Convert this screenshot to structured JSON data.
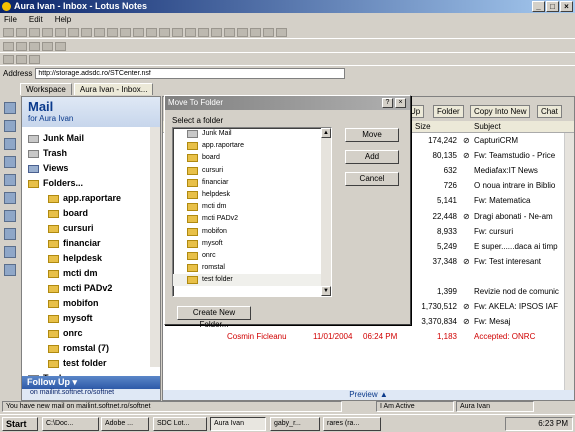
{
  "window": {
    "title": "Aura Ivan - Inbox - Lotus Notes",
    "min": "_",
    "max": "□",
    "close": "×"
  },
  "menu": [
    "File",
    "Edit",
    "Help"
  ],
  "address": {
    "label": "Address",
    "value": "http://storage.adsdc.ro/STCenter.nsf"
  },
  "tabs": [
    {
      "label": "Workspace"
    },
    {
      "label": "Aura Ivan - Inbox..."
    }
  ],
  "nav": {
    "title": "Mail",
    "subtitle": "for Aura Ivan",
    "items": [
      {
        "label": "Junk Mail"
      },
      {
        "label": "Trash"
      },
      {
        "label": "Views"
      },
      {
        "label": "Folders..."
      }
    ],
    "folders": [
      "app.raportare",
      "board",
      "cursuri",
      "financiar",
      "helpdesk",
      "mcti dm",
      "mcti PADv2",
      "mobifon",
      "mysoft",
      "onrc",
      "romstal (7)",
      "test folder"
    ],
    "tools": "Tools",
    "follow_up": "Follow Up",
    "server": "on mailint.softnet.ro/softnet"
  },
  "actions": {
    "up": "Up",
    "folder": "Folder",
    "copy_into_new": "Copy Into New",
    "chat": "Chat"
  },
  "columns": {
    "size": "Size",
    "subject": "Subject"
  },
  "rows": [
    {
      "from": "",
      "date": "",
      "time": "",
      "size": "174,242",
      "attach": "⊘",
      "subject": "CapturiCRM"
    },
    {
      "from": "",
      "date": "",
      "time": "",
      "size": "80,135",
      "attach": "⊘",
      "subject": "Fw: Teamstudio - Price"
    },
    {
      "from": "",
      "date": "",
      "time": "",
      "size": "632",
      "attach": "",
      "subject": "Mediafax:IT News"
    },
    {
      "from": "",
      "date": "",
      "time": "",
      "size": "726",
      "attach": "",
      "subject": "O noua intrare in Biblio"
    },
    {
      "from": "",
      "date": "",
      "time": "",
      "size": "5,141",
      "attach": "",
      "subject": "Fw: Matematica"
    },
    {
      "from": "",
      "date": "",
      "time": "",
      "size": "22,448",
      "attach": "⊘",
      "subject": "Dragi abonati -  Ne-am"
    },
    {
      "from": "",
      "date": "",
      "time": "",
      "size": "8,933",
      "attach": "",
      "subject": "Fw: cursuri"
    },
    {
      "from": "",
      "date": "",
      "time": "",
      "size": "5,249",
      "attach": "",
      "subject": "E super......daca ai timp"
    },
    {
      "from": "",
      "date": "",
      "time": "",
      "size": "37,348",
      "attach": "⊘",
      "subject": "Fw: Test interesant"
    },
    {
      "from": "",
      "date": "",
      "time": "",
      "size": "",
      "attach": "",
      "subject": ""
    },
    {
      "from": "",
      "date": "",
      "time": "",
      "size": "1,399",
      "attach": "",
      "subject": "Revizie nod de comunic"
    },
    {
      "from": "",
      "date": "",
      "time": "",
      "size": "1,730,512",
      "attach": "⊘",
      "subject": "Fw: AKELA: IPSOS IAF"
    },
    {
      "from": "Mihaela Ciuciu",
      "date": "11/01/2004",
      "time": "01:26 PM",
      "size": "3,370,834",
      "attach": "⊘",
      "subject": "Fw: Mesaj"
    },
    {
      "from": "Cosmin Ficleanu",
      "date": "11/01/2004",
      "time": "06:24 PM",
      "size": "1,183",
      "attach": "",
      "subject": "Accepted: ONRC"
    }
  ],
  "preview": "Preview",
  "dialog": {
    "title": "Move To Folder",
    "help": "?",
    "close": "×",
    "label": "Select a folder",
    "folders": [
      "Junk Mail",
      "app.raportare",
      "board",
      "cursuri",
      "financiar",
      "helpdesk",
      "mcti dm",
      "mcti PADv2",
      "mobifon",
      "mysoft",
      "onrc",
      "romstal",
      "test folder"
    ],
    "move": "Move",
    "add": "Add",
    "cancel": "Cancel",
    "create": "Create New Folder..."
  },
  "status": {
    "msg": "You have new mail on mailint.softnet.ro/softnet",
    "active": "I Am Active",
    "user": "Aura Ivan"
  },
  "taskbar": {
    "start": "Start",
    "tasks": [
      "C:\\Doc...",
      "Adobe ...",
      "SDC Lot...",
      "Aura Ivan",
      "gaby_r...",
      "rares (ra..."
    ],
    "time": "6:23 PM"
  }
}
